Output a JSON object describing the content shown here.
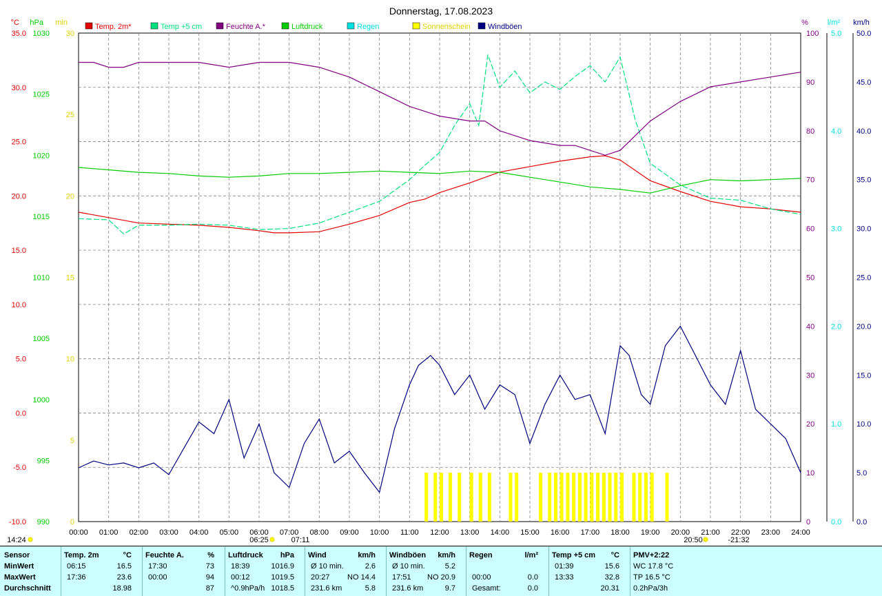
{
  "title": "Donnerstag, 17.08.2023",
  "colors": {
    "temp2m": "#e00000",
    "temp5cm": "#00e080",
    "humidity": "#800080",
    "pressure": "#00cc00",
    "rain": "#00e0e0",
    "sunshine": "#ffff00",
    "gusts": "#000080",
    "grid": "#808080",
    "stats_bg": "#ccffff"
  },
  "left_axes": [
    {
      "unit": "°C",
      "ticks": [
        "35.0",
        "30.0",
        "25.0",
        "20.0",
        "15.0",
        "10.0",
        "5.0",
        "0.0",
        "-5.0",
        "-10.0"
      ],
      "color": "#e00000"
    },
    {
      "unit": "hPa",
      "ticks": [
        "1030",
        "1025",
        "1020",
        "1015",
        "1010",
        "1005",
        "1000",
        "995",
        "990"
      ],
      "color": "#00cc00"
    },
    {
      "unit": "min",
      "ticks": [
        "30",
        "25",
        "20",
        "15",
        "10",
        "5",
        "0"
      ],
      "color": "#ffff00"
    }
  ],
  "right_axes": [
    {
      "unit": "%",
      "ticks": [
        "100",
        "90",
        "80",
        "70",
        "60",
        "50",
        "40",
        "30",
        "20",
        "10",
        "0"
      ],
      "color": "#800080"
    },
    {
      "unit": "l/m²",
      "ticks": [
        "5.0",
        "4.0",
        "3.0",
        "2.0",
        "1.0",
        "0.0"
      ],
      "color": "#00e0e0"
    },
    {
      "unit": "km/h",
      "ticks": [
        "50.0",
        "45.0",
        "40.0",
        "35.0",
        "30.0",
        "25.0",
        "20.0",
        "15.0",
        "10.0",
        "5.0",
        "0.0"
      ],
      "color": "#000080"
    }
  ],
  "x_ticks": [
    "00:00",
    "01:00",
    "02:00",
    "03:00",
    "04:00",
    "05:00",
    "06:00",
    "07:00",
    "08:00",
    "09:00",
    "10:00",
    "11:00",
    "12:00",
    "13:00",
    "14:00",
    "15:00",
    "16:00",
    "17:00",
    "18:00",
    "19:00",
    "20:00",
    "21:00",
    "22:00",
    "23:00",
    "24:00"
  ],
  "sun_marks": {
    "sunrise": "06:25",
    "noon": "07:11",
    "sunset": "20:50",
    "moon": "-21:32",
    "day_length": "14:24"
  },
  "legend": [
    {
      "label": "Temp. 2m*",
      "color": "#e00000"
    },
    {
      "label": "Temp +5 cm",
      "color": "#00e080"
    },
    {
      "label": "Feuchte A.*",
      "color": "#800080"
    },
    {
      "label": "Luftdruck",
      "color": "#00cc00"
    },
    {
      "label": "Regen",
      "color": "#00e0e0"
    },
    {
      "label": "Sonnenschein",
      "color": "#ffff00"
    },
    {
      "label": "Windböen",
      "color": "#000080"
    }
  ],
  "chart_data": {
    "type": "line",
    "title": "Donnerstag, 17.08.2023",
    "x_unit": "hour",
    "xlim": [
      0,
      24
    ],
    "grid": true,
    "legend_position": "top",
    "series": [
      {
        "name": "Temp. 2m*",
        "axis": "°C",
        "ylim": [
          -10,
          35
        ],
        "x": [
          0,
          1,
          2,
          3,
          4,
          5,
          6,
          6.5,
          7,
          8,
          9,
          10,
          11,
          11.5,
          12,
          13,
          14,
          15,
          16,
          17,
          17.5,
          18,
          19,
          20,
          21,
          22,
          23,
          24
        ],
        "y": [
          18.5,
          18.0,
          17.5,
          17.4,
          17.3,
          17.1,
          16.8,
          16.6,
          16.6,
          16.7,
          17.4,
          18.2,
          19.4,
          19.7,
          20.3,
          21.2,
          22.2,
          22.7,
          23.2,
          23.6,
          23.7,
          23.3,
          21.4,
          20.4,
          19.5,
          19.0,
          18.8,
          18.5
        ]
      },
      {
        "name": "Temp +5 cm",
        "axis": "°C",
        "ylim": [
          -10,
          35
        ],
        "x": [
          0,
          1,
          1.5,
          2,
          3,
          4,
          5,
          6,
          7,
          8,
          9,
          10,
          10.5,
          11,
          11.5,
          12,
          12.5,
          13,
          13.3,
          13.6,
          14,
          14.5,
          15,
          15.5,
          16,
          16.5,
          17,
          17.5,
          18,
          18.5,
          19,
          19.5,
          20,
          21,
          22,
          23,
          24
        ],
        "y": [
          17.9,
          17.8,
          16.5,
          17.3,
          17.3,
          17.4,
          17.3,
          16.9,
          17.0,
          17.5,
          18.5,
          19.5,
          20.5,
          21.5,
          22.8,
          24.0,
          26.5,
          28.5,
          26.5,
          33.0,
          30.0,
          31.5,
          29.5,
          30.5,
          29.8,
          31.0,
          32.0,
          30.5,
          32.8,
          27.0,
          23.0,
          22.0,
          21.0,
          19.8,
          19.6,
          18.8,
          18.3
        ]
      },
      {
        "name": "Feuchte A.*",
        "axis": "%",
        "ylim": [
          0,
          100
        ],
        "x": [
          0,
          0.5,
          1,
          1.5,
          2,
          3,
          4,
          5,
          6,
          7,
          8,
          9,
          10,
          11,
          12,
          13,
          13.5,
          14,
          14.5,
          15,
          16,
          16.5,
          17,
          17.5,
          18,
          19,
          20,
          21,
          22,
          23,
          24
        ],
        "y": [
          94,
          94,
          93,
          93,
          94,
          94,
          94,
          93,
          94,
          94,
          93,
          91,
          88,
          85,
          83,
          82,
          82,
          80,
          79,
          78,
          77,
          77,
          76,
          75,
          76,
          82,
          86,
          89,
          90,
          91,
          92
        ]
      },
      {
        "name": "Luftdruck",
        "axis": "hPa",
        "ylim": [
          990,
          1030
        ],
        "x": [
          0,
          1,
          2,
          3,
          4,
          5,
          6,
          7,
          8,
          9,
          10,
          11,
          12,
          13,
          14,
          15,
          16,
          17,
          18,
          19,
          20,
          21,
          22,
          23,
          24
        ],
        "y": [
          1019.0,
          1018.8,
          1018.6,
          1018.5,
          1018.3,
          1018.2,
          1018.3,
          1018.5,
          1018.5,
          1018.6,
          1018.7,
          1018.6,
          1018.5,
          1018.7,
          1018.6,
          1018.2,
          1017.8,
          1017.4,
          1017.2,
          1016.9,
          1017.5,
          1018.0,
          1017.9,
          1018.0,
          1018.1
        ]
      },
      {
        "name": "Windböen",
        "axis": "km/h",
        "ylim": [
          0,
          50
        ],
        "x": [
          0,
          0.5,
          1,
          1.5,
          2,
          2.5,
          3,
          3.5,
          4,
          4.5,
          5,
          5.5,
          6,
          6.5,
          7,
          7.5,
          8,
          8.5,
          9,
          9.5,
          10,
          10.5,
          11,
          11.3,
          11.7,
          12,
          12.5,
          13,
          13.5,
          14,
          14.5,
          15,
          15.5,
          16,
          16.5,
          17,
          17.5,
          18,
          18.3,
          18.7,
          19,
          19.5,
          20,
          20.5,
          21,
          21.5,
          22,
          22.5,
          23,
          23.5,
          24
        ],
        "y": [
          5.5,
          6.2,
          5.8,
          6.0,
          5.5,
          6.0,
          4.8,
          7.5,
          10.2,
          9.0,
          12.5,
          6.5,
          10.0,
          5.0,
          3.5,
          8.0,
          10.5,
          6.0,
          7.2,
          5.0,
          3.0,
          9.5,
          14.0,
          16.0,
          17.0,
          16.0,
          13.0,
          15.0,
          11.5,
          14.0,
          13.0,
          8.0,
          12.0,
          15.0,
          12.5,
          13.0,
          9.0,
          18.0,
          17.0,
          13.0,
          12.0,
          18.0,
          20.0,
          17.0,
          14.0,
          12.0,
          17.5,
          11.5,
          10.0,
          8.5,
          5.0
        ]
      },
      {
        "name": "Sonnenschein",
        "axis": "min",
        "ylim": [
          0,
          30
        ],
        "x": [
          11.5,
          11.8,
          12.0,
          12.3,
          12.6,
          13.0,
          13.3,
          13.6,
          14.3,
          14.5,
          15.3,
          15.6,
          15.8,
          16.0,
          16.2,
          16.4,
          16.6,
          16.8,
          17.0,
          17.2,
          17.4,
          17.6,
          17.8,
          18.0,
          18.4,
          18.6,
          18.8,
          19.0,
          19.5
        ],
        "y": [
          3,
          3,
          3,
          3,
          3,
          3,
          3,
          3,
          3,
          3,
          3,
          3,
          3,
          3,
          3,
          3,
          3,
          3,
          3,
          3,
          3,
          3,
          3,
          3,
          3,
          3,
          3,
          3,
          3
        ]
      }
    ]
  },
  "stats": {
    "columns": [
      {
        "title": "Sensor",
        "unit": "",
        "rows": [
          "MinWert",
          "MaxWert",
          "Durchschnitt"
        ]
      },
      {
        "title": "Temp. 2m",
        "unit": "°C",
        "rows": [
          [
            "06:15",
            "16.5"
          ],
          [
            "17:36",
            "23.6"
          ],
          [
            "",
            "18.98"
          ]
        ]
      },
      {
        "title": "Feuchte A.",
        "unit": "%",
        "rows": [
          [
            "17:30",
            "73"
          ],
          [
            "00:00",
            "94"
          ],
          [
            "",
            "87"
          ]
        ]
      },
      {
        "title": "Luftdruck",
        "unit": "hPa",
        "rows": [
          [
            "18:39",
            "1016.9"
          ],
          [
            "00:12",
            "1019.5"
          ],
          [
            "^0.9hPa/h",
            "1018.5"
          ]
        ]
      },
      {
        "title": "Wind",
        "unit": "km/h",
        "rows": [
          [
            "Ø 10 min.",
            "2.6"
          ],
          [
            "20:27",
            "NO 14.4"
          ],
          [
            "231.6 km",
            "5.8"
          ]
        ]
      },
      {
        "title": "Windböen",
        "unit": "km/h",
        "rows": [
          [
            "Ø 10 min.",
            "5.2"
          ],
          [
            "17:51",
            "NO 20.9"
          ],
          [
            "231.6 km",
            "9.7"
          ]
        ]
      },
      {
        "title": "Regen",
        "unit": "l/m²",
        "rows": [
          [
            "",
            ""
          ],
          [
            "00:00",
            "0.0"
          ],
          [
            "Gesamt:",
            "0.0"
          ]
        ]
      },
      {
        "title": "Temp +5 cm",
        "unit": "°C",
        "rows": [
          [
            "01:39",
            "15.6"
          ],
          [
            "13:33",
            "32.8"
          ],
          [
            "",
            "20.31"
          ]
        ]
      },
      {
        "title": "PMV+2:22",
        "unit": "",
        "rows": [
          "WC 17.8 °C",
          "TP 16.5 °C",
          "0.2hPa/3h"
        ]
      }
    ]
  }
}
